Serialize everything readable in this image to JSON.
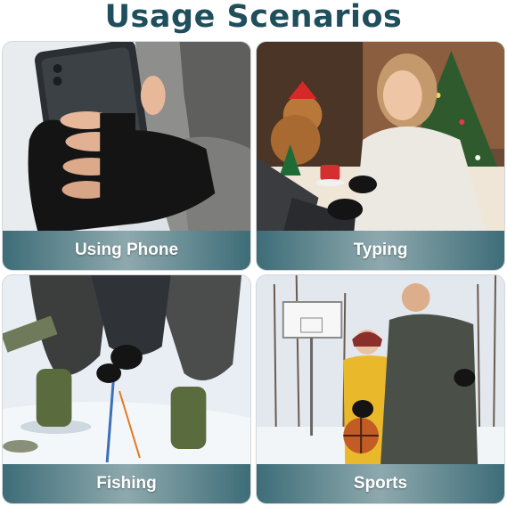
{
  "title": "Usage Scenarios",
  "scenes": [
    {
      "label": "Using Phone"
    },
    {
      "label": "Typing"
    },
    {
      "label": "Fishing"
    },
    {
      "label": "Sports"
    }
  ],
  "colors": {
    "title": "#1f4f5c",
    "caption_dark": "#3d6d78",
    "caption_light": "#8ea9ae",
    "glove": "#141414"
  }
}
